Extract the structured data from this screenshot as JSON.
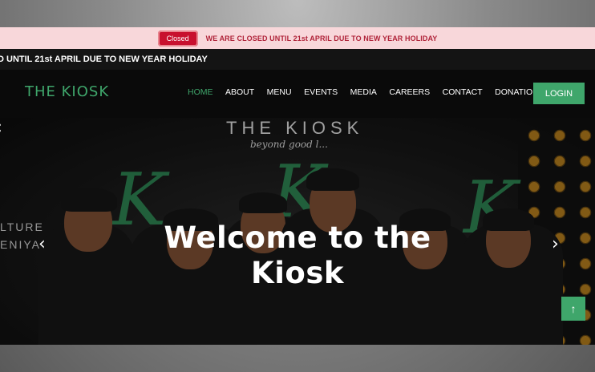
{
  "notice": {
    "badge": "Closed",
    "text": "WE ARE CLOSED UNTIL 21st APRIL DUE TO NEW YEAR HOLIDAY"
  },
  "ticker": {
    "text": "D UNTIL 21st APRIL DUE TO NEW YEAR HOLIDAY"
  },
  "navbar": {
    "brand": "THE KIOSK",
    "links": [
      "HOME",
      "ABOUT",
      "MENU",
      "EVENTS",
      "MEDIA",
      "CAREERS",
      "CONTACT",
      "DONATIONS"
    ],
    "active": "HOME",
    "login": "LOGIN"
  },
  "hero": {
    "sign_title": "THE KIOSK",
    "sign_tagline": "beyond good l...",
    "wall_text_1": "LTURE",
    "wall_text_2": "ENIYA",
    "title_line1": "Welcome to the",
    "title_line2": "Kiosk",
    "prev_icon": "chevron-left-icon",
    "next_icon": "chevron-right-icon"
  },
  "scroll_top": {
    "icon": "arrow-up-icon",
    "glyph": "↑"
  },
  "colors": {
    "accent": "#3fa66b",
    "badge_red": "#c8102e",
    "notice_bg": "#f8d7da"
  }
}
